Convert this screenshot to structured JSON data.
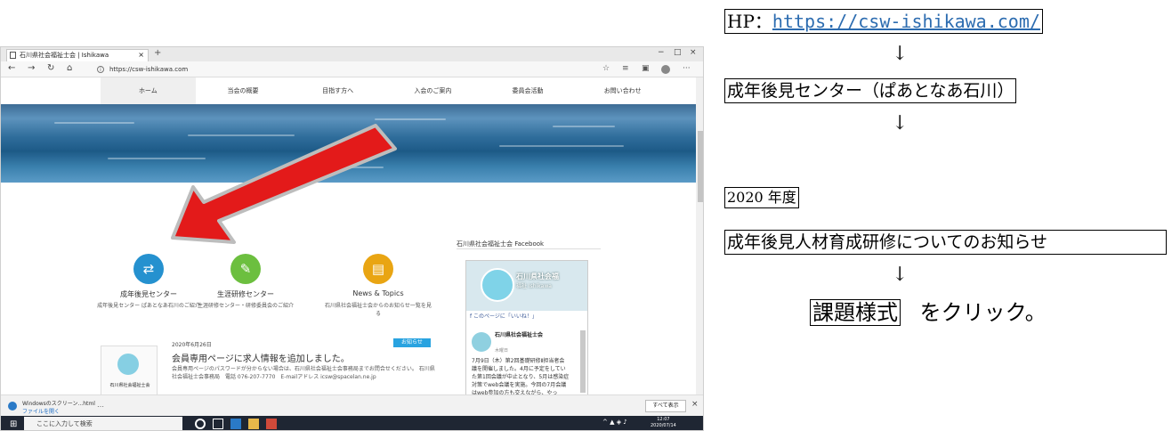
{
  "browser": {
    "tab_title": "石川県社会福祉士会 | Ishikawa",
    "tab_close": "×",
    "new_tab": "+",
    "win_min": "−",
    "win_max": "□",
    "win_close": "×",
    "url": "https://csw-ishikawa.com"
  },
  "site": {
    "menu": [
      "ホーム",
      "当会の概要",
      "目指す方へ",
      "入会のご案内",
      "委員会活動",
      "お問い合わせ"
    ],
    "cards": [
      {
        "title": "成年後見センター",
        "desc": "成年後見センター ぱあとなあ石川のご紹介",
        "color": "#2591cf"
      },
      {
        "title": "生涯研修センター",
        "desc": "生涯研修センター・研修委員会のご紹介",
        "color": "#6cbf3f"
      },
      {
        "title": "News & Topics",
        "desc": "石川県社会福祉士会からのお知らせ一覧を見る",
        "color": "#e9a513"
      }
    ],
    "facebook": {
      "section_title": "石川県社会福祉士会 Facebook",
      "page_name": "石川県社会福",
      "page_sub": "福祉 Ishikawa",
      "like_button": "このページに「いいね！」",
      "post_author": "石川県社会福祉士会",
      "post_time": "木曜日",
      "post_text": "7月9日（木）第2回基礎研修Ⅱ担当者会議を開催しました。4月に予定をしていた第1回会議が中止となり、5月は感染症対策でweb会議を実施。今回の7月会議はweb参加の方も交えながら、やっ"
    },
    "news": {
      "date": "2020年6月26日",
      "badge": "お知らせ",
      "title": "会員専用ページに求人情報を追加しました。",
      "text": "会員専用ページのパスワードが分からない場合は、石川県社会福祉士会事務局までお問合せください。 石川県社会福祉士会事務局　電話 076-207-7770　E-mailアドレス icsw@spacelan.ne.jp",
      "logo_caption": "石川県社会福祉士会"
    }
  },
  "download": {
    "file_name": "Windowsのスクリーン...html",
    "open_label": "ファイルを開く",
    "more": "…",
    "show_all": "すべて表示",
    "close": "×"
  },
  "taskbar": {
    "search_placeholder": "ここに入力して検索",
    "time": "12:07",
    "date": "2020/07/14"
  },
  "steps": {
    "hp_label": "HP：",
    "hp_url": "https://csw-ishikawa.com/",
    "arrow": "↓",
    "center": "成年後見センター（ぱあとなあ石川）",
    "year": "2020 年度",
    "notice": "成年後見人材育成研修についてのお知らせ",
    "form_link": "課題様式",
    "click_text": "をクリック。"
  }
}
